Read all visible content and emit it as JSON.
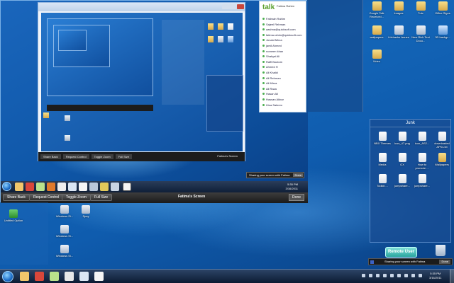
{
  "left": {
    "folder_chip": "Folders"
  },
  "desktop_right_icons": [
    {
      "label": "Google Talk Received...",
      "kind": "g-folder"
    },
    {
      "label": "Images",
      "kind": "g-folder"
    },
    {
      "label": "Tutc",
      "kind": "g-folder"
    },
    {
      "label": "Office Signs",
      "kind": "g-folder"
    },
    {
      "label": "wallpapers",
      "kind": "g-folder"
    },
    {
      "label": "Lifehacks Issues",
      "kind": "g-doc"
    },
    {
      "label": "New Rich Text Docu...",
      "kind": "g-doc"
    },
    {
      "label": "3D backgr...",
      "kind": "g-img"
    },
    {
      "label": "Video",
      "kind": "g-folder"
    }
  ],
  "junk": {
    "title": "Junk",
    "items": [
      {
        "label": "NBX Themes",
        "kind": "g-file"
      },
      {
        "label": "icon_47.png",
        "kind": "g-file"
      },
      {
        "label": "icon_AS2...",
        "kind": "g-file"
      },
      {
        "label": "downloaded APKs.txt",
        "kind": "g-file"
      },
      {
        "label": "Media",
        "kind": "g-file"
      },
      {
        "label": "GX",
        "kind": "g-file"
      },
      {
        "label": "How to promote ...",
        "kind": "g-file"
      },
      {
        "label": "Wallpapers",
        "kind": "g-folder"
      },
      {
        "label": "Toolkit....",
        "kind": "g-file"
      },
      {
        "label": "jumpshare...",
        "kind": "g-file"
      },
      {
        "label": "jumpshare...",
        "kind": "g-file"
      }
    ]
  },
  "share_window": {
    "toolbar": {
      "share_back": "Share Back",
      "request_control": "Request Control",
      "toggle_zoom": "Toggle Zoom",
      "full_size": "Full Size"
    },
    "title": "Fatima's Screen",
    "done": "Done",
    "clock": {
      "time": "5:35 PM",
      "date": "3/16/2011"
    },
    "nested_notice": {
      "text": "Sharing your screen with Fatima",
      "done": "Done"
    },
    "nested_window": {
      "caption": "Fatima's Screen",
      "toolbar": [
        "Share Back",
        "Request Control",
        "Toggle Zoom",
        "Full Size"
      ]
    },
    "gtalk": {
      "logo": "talk",
      "status": "Fatima Rahim",
      "contacts": [
        "Fatimah Rahim",
        "Sajeel Rehman",
        "aashna@quicksoft.com",
        "fatima.rahim@quicksoft.com",
        "Junaid Mirza",
        "jamil Ahmed",
        "nomeen khan",
        "Shafqat Ali",
        "Raffi Boutom",
        "Ahmed H",
        "Ali Khalid",
        "Ali Rehman",
        "Ali Mirza",
        "Ali Raza",
        "Hasan Ali",
        "Hassan Akbar",
        "Hina Saleem"
      ]
    }
  },
  "desktop_left_icons": [
    {
      "label": "Untitled Option",
      "kind": "g-app"
    },
    {
      "label": "Windows Si...",
      "kind": "g-doc"
    },
    {
      "label": "Spey",
      "kind": "g-doc"
    },
    {
      "label": "Windows Si...",
      "kind": "g-doc"
    },
    {
      "label": "Windows Si...",
      "kind": "g-doc"
    }
  ],
  "remote": {
    "pill": "Remote User",
    "sharing_text": "Sharing your screen with Fatima",
    "done": "Done"
  },
  "taskbar": {
    "clock": {
      "time": "5:35 PM",
      "date": "3/16/2011"
    },
    "apps": [
      {
        "name": "explorer-icon",
        "color": "#f2c76b"
      },
      {
        "name": "chrome-icon",
        "color": "#d9473b"
      },
      {
        "name": "gtalk-icon",
        "color": "#b9e28b"
      },
      {
        "name": "sticky-icon",
        "color": "#e8e8e8"
      },
      {
        "name": "document-icon",
        "color": "#dbe6f3"
      },
      {
        "name": "jumpshare-icon",
        "color": "#f5f5f5"
      }
    ]
  }
}
